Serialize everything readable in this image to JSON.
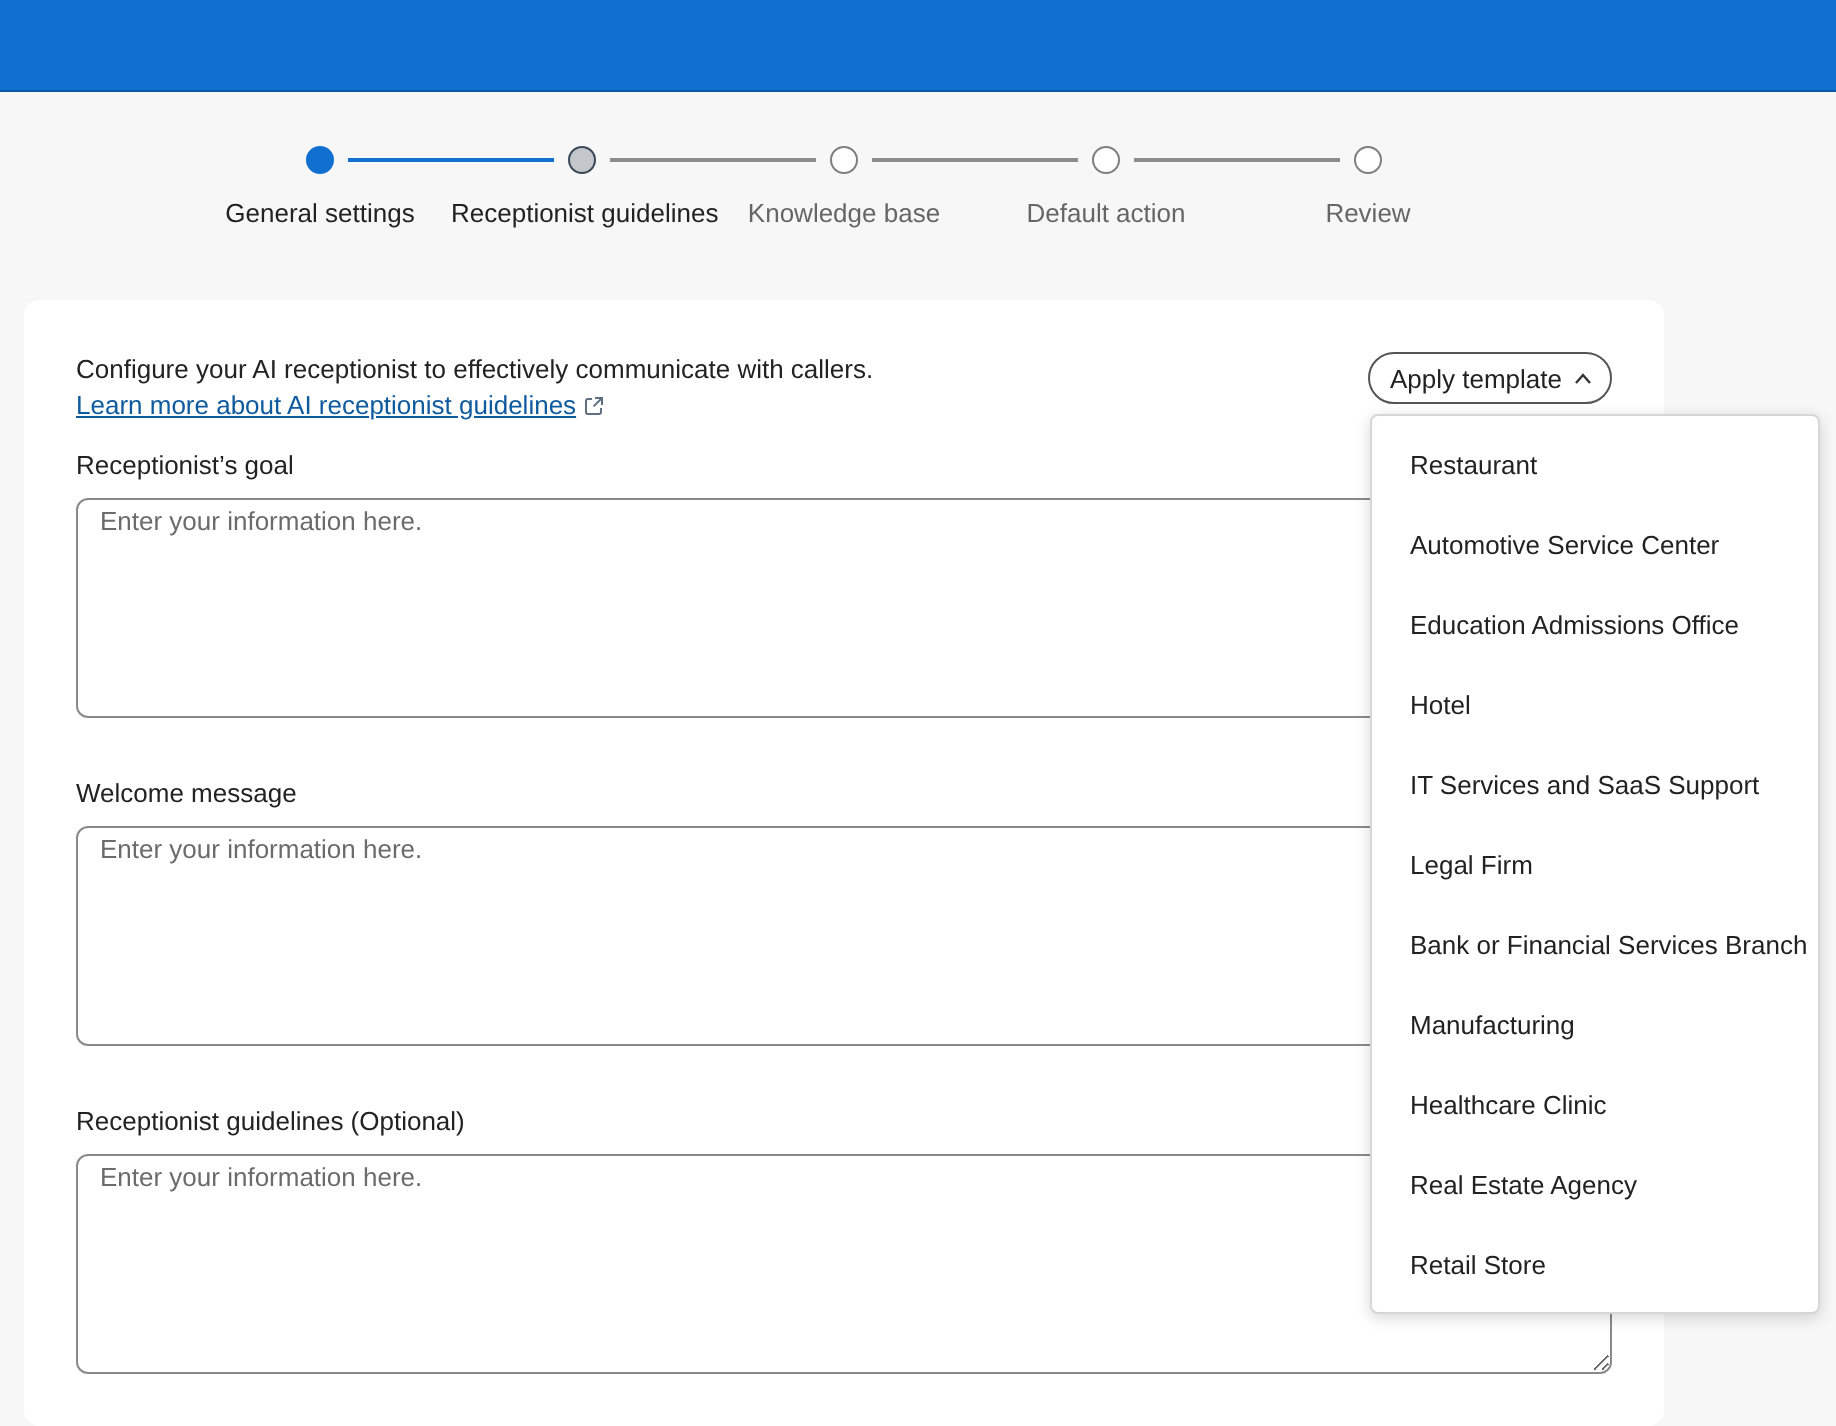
{
  "stepper": {
    "steps": [
      {
        "label": "General settings",
        "completed": true,
        "selected": false
      },
      {
        "label": "Receptionist guidelines",
        "completed": false,
        "selected": true
      },
      {
        "label": "Knowledge base",
        "completed": false,
        "selected": false
      },
      {
        "label": "Default action",
        "completed": false,
        "selected": false
      },
      {
        "label": "Review",
        "completed": false,
        "selected": false
      }
    ]
  },
  "form": {
    "intro": {
      "text": "Configure your AI receptionist to effectively communicate with callers.",
      "link": "Learn more about AI receptionist guidelines"
    },
    "template_button": {
      "label": "Apply template",
      "expanded": true,
      "options": [
        "Restaurant",
        "Automotive Service Center",
        "Education Admissions Office",
        "Hotel",
        "IT Services and SaaS Support",
        "Legal Firm",
        "Bank or Financial Services Branch",
        "Manufacturing",
        "Healthcare Clinic",
        "Real Estate Agency",
        "Retail Store"
      ]
    },
    "fields": [
      {
        "label": "Receptionist’s goal",
        "placeholder": "Enter your information here."
      },
      {
        "label": "Welcome message",
        "placeholder": "Enter your information here."
      },
      {
        "label": "Receptionist guidelines (Optional)",
        "placeholder": "Enter your information here."
      }
    ]
  }
}
